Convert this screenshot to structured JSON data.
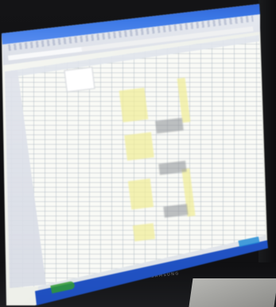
{
  "scene": {
    "description_type": "photo-of-monitor",
    "monitor_brand": "SAMSUNG"
  },
  "window": {
    "title": "",
    "app": "spreadsheet"
  },
  "colors": {
    "titlebar": "#3b78e6",
    "taskbar": "#1f4fbf",
    "highlight_yellow": "#f2ee9a",
    "highlight_gray": "#8c8f94",
    "sheet_background": "#f9faf6"
  }
}
